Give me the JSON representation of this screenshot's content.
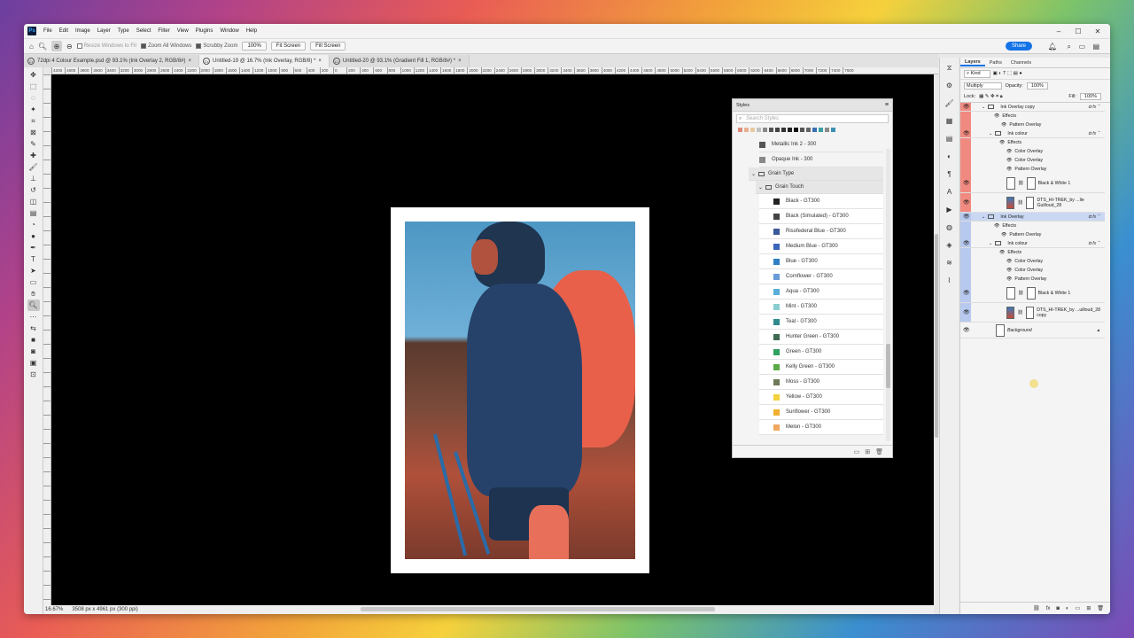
{
  "app": {
    "logo": "Ps",
    "menu": [
      "File",
      "Edit",
      "Image",
      "Layer",
      "Type",
      "Select",
      "Filter",
      "View",
      "Plugins",
      "Window",
      "Help"
    ]
  },
  "options": {
    "resize_windows": "Resize Windows to Fit",
    "zoom_all": "Zoom All Windows",
    "scrubby": "Scrubby Zoom",
    "zoom_value": "100%",
    "fit_screen": "Fit Screen",
    "fill_screen": "Fill Screen",
    "share": "Share"
  },
  "tabs": [
    "72dpi 4 Colour Example.psd @ 93.1% (Ink Overlay 2, RGB/8#)",
    "Untitled-19 @ 16.7% (Ink Overlay, RGB/8) *",
    "Untitled-20 @ 93.1% (Gradient Fill 1, RGB/8#) *"
  ],
  "ruler": [
    "4200",
    "4000",
    "3800",
    "3600",
    "3400",
    "3200",
    "3000",
    "2800",
    "2600",
    "2400",
    "2200",
    "2000",
    "1800",
    "1600",
    "1400",
    "1200",
    "1000",
    "800",
    "600",
    "400",
    "200",
    "0",
    "200",
    "400",
    "600",
    "800",
    "1000",
    "1200",
    "1400",
    "1600",
    "1800",
    "2000",
    "2200",
    "2400",
    "2600",
    "2800",
    "3000",
    "3200",
    "3400",
    "3600",
    "3800",
    "4000",
    "4200",
    "4400",
    "4600",
    "4800",
    "5000",
    "5200",
    "5400",
    "5600",
    "5800",
    "6000",
    "6200",
    "6400",
    "6600",
    "6800",
    "7000",
    "7200",
    "7400",
    "7600"
  ],
  "status": {
    "zoom": "16.67%",
    "info": "3508 px x 4961 px (300 ppi)"
  },
  "styles": {
    "title": "Styles",
    "search_placeholder": "Search Styles",
    "top_swatches": [
      "#e08a7a",
      "#e8b090",
      "#e8c8a0",
      "#c0c0c0",
      "#888888",
      "#555555",
      "#444444",
      "#333333",
      "#222222",
      "#111111",
      "#555555",
      "#666666",
      "#3a6fb0",
      "#3aa0a0",
      "#8a8a8a",
      "#3a90b0"
    ],
    "pre_items": [
      {
        "label": "Metallic Ink 2 - 300",
        "color": "#555555"
      },
      {
        "label": "Opaque Ink - 300",
        "color": "#888888"
      }
    ],
    "group1": "Grain Type",
    "group2": "Grain Touch",
    "items": [
      {
        "label": "Black - GT300",
        "color": "#222222"
      },
      {
        "label": "Black (Simulated) - GT300",
        "color": "#444444"
      },
      {
        "label": "Risofederal Blue - GT300",
        "color": "#3c5a9a"
      },
      {
        "label": "Medium Blue - GT300",
        "color": "#3a68b8"
      },
      {
        "label": "Blue - GT300",
        "color": "#2f7fc4"
      },
      {
        "label": "Cornflower - GT300",
        "color": "#6a9bd8"
      },
      {
        "label": "Aqua - GT300",
        "color": "#5aaed8"
      },
      {
        "label": "Mint - GT300",
        "color": "#8acdd0"
      },
      {
        "label": "Teal - GT300",
        "color": "#2f8a8f"
      },
      {
        "label": "Hunter Green - GT300",
        "color": "#3f6b52"
      },
      {
        "label": "Green - GT300",
        "color": "#2fa060"
      },
      {
        "label": "Kelly Green - GT300",
        "color": "#5aaa48"
      },
      {
        "label": "Moss - GT300",
        "color": "#6f7a58"
      },
      {
        "label": "Yellow - GT300",
        "color": "#f2d23a"
      },
      {
        "label": "Sunflower - GT300",
        "color": "#f0b030"
      },
      {
        "label": "Melon - GT300",
        "color": "#f0a860"
      }
    ]
  },
  "layers": {
    "tabs": [
      "Layers",
      "Paths",
      "Channels"
    ],
    "kind": "Kind",
    "blend": "Multiply",
    "opacity_label": "Opacity:",
    "opacity": "100%",
    "lock_label": "Lock:",
    "fill_label": "Fill:",
    "fill": "100%",
    "rows": [
      {
        "label": "Ink Overlay copy",
        "indent": 12,
        "eye": true,
        "bg": "#f08a80",
        "fx": true
      },
      {
        "label": "Effects",
        "indent": 26,
        "eye": false,
        "bg": "#f08a80"
      },
      {
        "label": "Pattern Overlay",
        "indent": 34,
        "eye": false,
        "bg": "#f08a80"
      },
      {
        "label": "Ink colour",
        "indent": 20,
        "eye": true,
        "bg": "#f08a80",
        "fx": true
      },
      {
        "label": "Effects",
        "indent": 32,
        "eye": false,
        "bg": "#f08a80"
      },
      {
        "label": "Color Overlay",
        "indent": 40,
        "eye": false,
        "bg": "#f08a80"
      },
      {
        "label": "Color Overlay",
        "indent": 40,
        "eye": false,
        "bg": "#f08a80"
      },
      {
        "label": "Pattern Overlay",
        "indent": 40,
        "eye": false,
        "bg": "#f08a80"
      },
      {
        "label": "Black & White 1",
        "indent": 40,
        "eye": true,
        "bg": "#f08a80"
      },
      {
        "label": "DTS_HI-TREK_by ...lie Guilloud_28",
        "indent": 40,
        "eye": true,
        "bg": "#f08a80"
      },
      {
        "label": "Ink Overlay",
        "indent": 12,
        "eye": true,
        "bg": "#b7c9ee",
        "fx": true
      },
      {
        "label": "Effects",
        "indent": 26,
        "eye": false,
        "bg": "#b7c9ee"
      },
      {
        "label": "Pattern Overlay",
        "indent": 34,
        "eye": false,
        "bg": "#b7c9ee"
      },
      {
        "label": "Ink colour",
        "indent": 20,
        "eye": true,
        "bg": "#b7c9ee",
        "fx": true
      },
      {
        "label": "Effects",
        "indent": 32,
        "eye": false,
        "bg": "#b7c9ee"
      },
      {
        "label": "Color Overlay",
        "indent": 40,
        "eye": false,
        "bg": "#b7c9ee"
      },
      {
        "label": "Color Overlay",
        "indent": 40,
        "eye": false,
        "bg": "#b7c9ee"
      },
      {
        "label": "Pattern Overlay",
        "indent": 40,
        "eye": false,
        "bg": "#b7c9ee"
      },
      {
        "label": "Black & White 1",
        "indent": 40,
        "eye": true,
        "bg": "#b7c9ee"
      },
      {
        "label": "DTS_HI-TREK_by ...uilloud_28 copy",
        "indent": 40,
        "eye": true,
        "bg": "#b7c9ee"
      },
      {
        "label": "Background",
        "indent": 28,
        "eye": true,
        "bg": "#f4f4f4"
      }
    ]
  }
}
